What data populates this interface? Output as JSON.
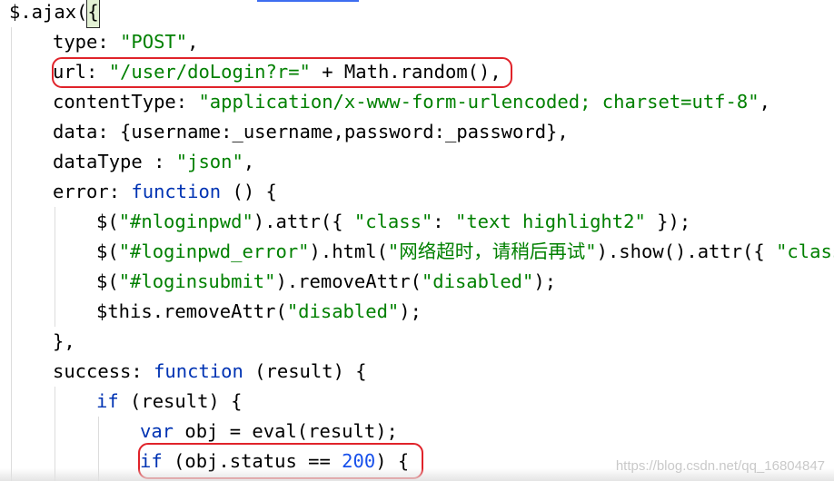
{
  "code": {
    "l1": {
      "p1": "$.ajax(",
      "brace": "{"
    },
    "l2": {
      "p1": "type: ",
      "s1": "\"POST\"",
      "p2": ","
    },
    "l3": {
      "p1": "url: ",
      "s1": "\"/user/doLogin?r=\"",
      "p2": " + Math.random(),"
    },
    "l4": {
      "p1": "contentType: ",
      "s1": "\"application/x-www-form-urlencoded; charset=utf-8\"",
      "p2": ","
    },
    "l5": {
      "p1": "data: {username:_username,password:_password},"
    },
    "l6": {
      "p1": "dataType : ",
      "s1": "\"json\"",
      "p2": ","
    },
    "l7": {
      "p1": "error: ",
      "k1": "function",
      "p2": " () {"
    },
    "l8": {
      "p1": "$(",
      "s1": "\"#nloginpwd\"",
      "p2": ").attr({ ",
      "s2": "\"class\"",
      "p3": ": ",
      "s3": "\"text highlight2\"",
      "p4": " });"
    },
    "l9": {
      "p1": "$(",
      "s1": "\"#loginpwd_error\"",
      "p2": ").html(",
      "s2": "\"网络超时，请稍后再试\"",
      "p3": ").show().attr({ ",
      "s3": "\"class"
    },
    "l10": {
      "p1": "$(",
      "s1": "\"#loginsubmit\"",
      "p2": ").removeAttr(",
      "s2": "\"disabled\"",
      "p3": ");"
    },
    "l11": {
      "p1": "$this.removeAttr(",
      "s1": "\"disabled\"",
      "p2": ");"
    },
    "l12": {
      "p1": "},"
    },
    "l13": {
      "p1": "success: ",
      "k1": "function",
      "p2": " (result) {"
    },
    "l14": {
      "k1": "if",
      "p1": " (result) {"
    },
    "l15": {
      "k1": "var",
      "p1": " obj = eval(result);"
    },
    "l16": {
      "k1": "if",
      "p1": " (obj.status == ",
      "n1": "200",
      "p2": ") {"
    }
  },
  "watermark": "https://blog.csdn.net/qq_16804847",
  "colors": {
    "string": "#008000",
    "keyword": "#0033b3",
    "number": "#1750eb",
    "highlight_box": "#e0232a"
  }
}
